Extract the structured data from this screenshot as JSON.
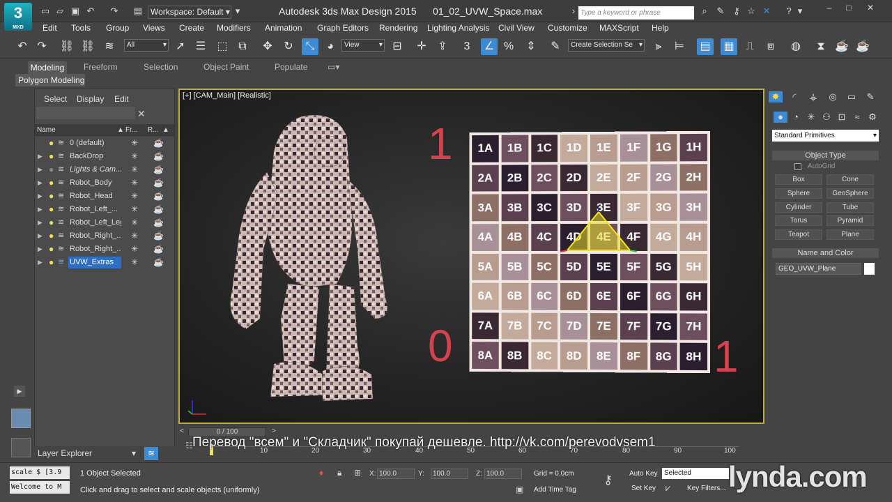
{
  "app": {
    "logo": "3",
    "logo_sub": "MXD",
    "title": "Autodesk 3ds Max Design 2015",
    "file": "01_02_UVW_Space.max",
    "workspace": "Workspace: Default",
    "search_placeholder": "Type a keyword or phrase"
  },
  "menu": [
    "Edit",
    "Tools",
    "Group",
    "Views",
    "Create",
    "Modifiers",
    "Animation",
    "Graph Editors",
    "Rendering",
    "Lighting Analysis",
    "Civil View",
    "Customize",
    "MAXScript",
    "Help"
  ],
  "toolbar": {
    "filter": "All",
    "ref_coord": "View",
    "selection_set": "Create Selection Se",
    "snap_num": "3",
    "accent": "#3d8bd4"
  },
  "ribbon": {
    "tabs": [
      "Modeling",
      "Freeform",
      "Selection",
      "Object Paint",
      "Populate"
    ],
    "panel": "Polygon Modeling"
  },
  "explorer": {
    "tabs": [
      "Select",
      "Display",
      "Edit"
    ],
    "col_name": "Name",
    "col_freeze": "Fr...",
    "col_render": "R...",
    "layers": [
      "0 (default)",
      "BackDrop",
      "Lights & Cam...",
      "Robot_Body",
      "Robot_Head",
      "Robot_Left_...",
      "Robot_Left_Leg",
      "Robot_Right_...",
      "Robot_Right_...",
      "UVW_Extras"
    ],
    "selected": "UVW_Extras",
    "footer": "Layer Explorer"
  },
  "viewport": {
    "label": "[+] [CAM_Main] [Realistic]",
    "num_top": "1",
    "num_bottom_left": "0",
    "num_bottom_right": "1",
    "grid_rows": [
      "1",
      "2",
      "3",
      "4",
      "5",
      "6",
      "7",
      "8"
    ],
    "grid_cols": [
      "A",
      "B",
      "C",
      "D",
      "E",
      "F",
      "G",
      "H"
    ]
  },
  "command_panel": {
    "category": "Standard Primitives",
    "object_type": "Object Type",
    "autogrid": "AutoGrid",
    "buttons": [
      "Box",
      "Cone",
      "Sphere",
      "GeoSphere",
      "Cylinder",
      "Tube",
      "Torus",
      "Pyramid",
      "Teapot",
      "Plane"
    ],
    "name_color": "Name and Color",
    "object_name": "GEO_UVW_Plane"
  },
  "timeline": {
    "slider": "0 / 100",
    "watermark": "Перевод \"всем\" и \"Складчик\" покупай дешевле. http://vk.com/perevodvsem1",
    "ticks": [
      "0",
      "10",
      "20",
      "30",
      "40",
      "50",
      "60",
      "70",
      "80",
      "90",
      "100"
    ]
  },
  "status": {
    "script1": "scale $ [3.9",
    "script2": "Welcome to M",
    "selected": "1 Object Selected",
    "prompt": "Click and drag to select and scale objects (uniformly)",
    "x": "100.0",
    "y": "100.0",
    "z": "100.0",
    "grid": "Grid = 0.0cm",
    "add_time_tag": "Add Time Tag",
    "auto_key": "Auto Key",
    "set_key": "Set Key",
    "key_mode": "Selected",
    "key_filters": "Key Filters...",
    "brand": "lynda.com"
  }
}
